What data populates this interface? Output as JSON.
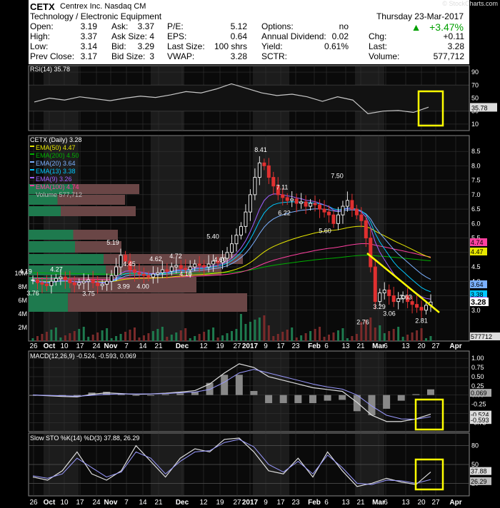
{
  "watermark": "© StockCharts.com",
  "header": {
    "ticker": "CETX",
    "company": "Centrex Inc.",
    "exchange": "Nasdaq CM",
    "sector": "Technology / Electronic Equipment",
    "date": "Thursday 23-Mar-2017",
    "change_pct": "+3.47%",
    "rows": [
      {
        "l1": "Open:",
        "v1": "3.19",
        "l2": "Ask:",
        "v2": "3.37",
        "l3": "P/E:",
        "v3": "5.12",
        "l4": "Options:",
        "v4": "no",
        "l5": "",
        "v5": ""
      },
      {
        "l1": "High:",
        "v1": "3.37",
        "l2": "Ask Size:",
        "v2": "4",
        "l3": "EPS:",
        "v3": "0.64",
        "l4": "Annual Dividend:",
        "v4": "0.02",
        "l5": "Chg:",
        "v5": "+0.11"
      },
      {
        "l1": "Low:",
        "v1": "3.14",
        "l2": "Bid:",
        "v2": "3.29",
        "l3": "Last Size:",
        "v3": "100 shrs",
        "l4": "Yield:",
        "v4": "0.61%",
        "l5": "Last:",
        "v5": "3.28"
      },
      {
        "l1": "Prev Close:",
        "v1": "3.17",
        "l2": "Bid Size:",
        "v2": "3",
        "l3": "VWAP:",
        "v3": "3.28",
        "l4": "SCTR:",
        "v4": "",
        "l5": "Volume:",
        "v5": "577,712"
      }
    ]
  },
  "colors": {
    "ema50": "#e6e600",
    "ema200": "#00b000",
    "ema20": "#7ab0ff",
    "ema13": "#00c8ff",
    "ema9": "#a060ff",
    "ema100": "#ff40a0",
    "candle_up": "#e8e8e8",
    "candle_down": "#e03030",
    "trendline": "#ffff00",
    "highlight_box": "#ffff00"
  },
  "chart_data": [
    {
      "type": "line",
      "panel": "RSI",
      "title": "RSI(14) 35.78",
      "last_label": "35.78",
      "y_ticks": [
        "90",
        "70",
        "50",
        "30",
        "10"
      ],
      "ylim": [
        0,
        100
      ],
      "x": [
        "Sep 26",
        "Oct 3",
        "Oct 10",
        "Oct 17",
        "Oct 24",
        "Oct 31",
        "Nov 7",
        "Nov 14",
        "Nov 21",
        "Nov 28",
        "Dec 5",
        "Dec 12",
        "Dec 19",
        "Dec 27",
        "Jan 3",
        "Jan 9",
        "Jan 17",
        "Jan 23",
        "Jan 30",
        "Feb 6",
        "Feb 13",
        "Feb 21",
        "Feb 27",
        "Mar 6",
        "Mar 13",
        "Mar 20",
        "Mar 23"
      ],
      "values": [
        44,
        50,
        47,
        52,
        49,
        46,
        50,
        53,
        51,
        55,
        60,
        58,
        64,
        72,
        65,
        58,
        54,
        56,
        52,
        45,
        52,
        47,
        26,
        30,
        31,
        28,
        36
      ]
    },
    {
      "type": "candlestick",
      "panel": "Price",
      "title": "CETX (Daily) 3.28",
      "legend": [
        "EMA(50) 4.47",
        "EMA(200) 4.50",
        "EMA(20) 3.64",
        "EMA(13) 3.38",
        "EMA(9) 3.26",
        "EMA(100) 4.74",
        "Volume 577,712"
      ],
      "y_ticks": [
        "8.5",
        "8.0",
        "7.5",
        "7.0",
        "6.5",
        "6.0",
        "5.5",
        "5.0",
        "4.5",
        "4.0",
        "3.5",
        "3.0"
      ],
      "volume_ticks": [
        "10M",
        "8M",
        "6M",
        "4M",
        "2M"
      ],
      "ylim": [
        2.5,
        8.8
      ],
      "x_labels": [
        "26",
        "Oct",
        "10",
        "17",
        "24",
        "Nov",
        "7",
        "14",
        "21",
        "Dec",
        "12",
        "19",
        "27",
        "2017",
        "9",
        "17",
        "23",
        "Feb",
        "6",
        "13",
        "21",
        "Mar",
        "6",
        "13",
        "20",
        "27",
        "Apr"
      ],
      "annotations": [
        {
          "label": "4.19",
          "date": "Sep 26",
          "value": 4.19
        },
        {
          "label": "3.76",
          "date": "Sep 28",
          "value": 3.76
        },
        {
          "label": "4.27",
          "date": "Oct 6",
          "value": 4.27
        },
        {
          "label": "3.75",
          "date": "Oct 17",
          "value": 3.75
        },
        {
          "label": "5.19",
          "date": "Oct 31",
          "value": 5.19
        },
        {
          "label": "4.45",
          "date": "Nov 3",
          "value": 4.45
        },
        {
          "label": "3.99",
          "date": "Nov 1",
          "value": 3.99
        },
        {
          "label": "4.00",
          "date": "Nov 10",
          "value": 4.0
        },
        {
          "label": "4.62",
          "date": "Nov 17",
          "value": 4.62
        },
        {
          "label": "4.72",
          "date": "Nov 28",
          "value": 4.72
        },
        {
          "label": "4.10",
          "date": "Nov 30",
          "value": 4.1
        },
        {
          "label": "5.40",
          "date": "Dec 9",
          "value": 5.4
        },
        {
          "label": "4.60",
          "date": "Dec 13",
          "value": 4.6
        },
        {
          "label": "8.41",
          "date": "Jan 3",
          "value": 8.41
        },
        {
          "label": "7.11",
          "date": "Jan 9",
          "value": 7.11
        },
        {
          "label": "6.22",
          "date": "Jan 17",
          "value": 6.22
        },
        {
          "label": "7.50",
          "date": "Feb 10",
          "value": 7.5
        },
        {
          "label": "5.60",
          "date": "Feb 6",
          "value": 5.6
        },
        {
          "label": "3.63",
          "date": "Mar 13",
          "value": 3.63
        },
        {
          "label": "3.29",
          "date": "Mar 3",
          "value": 3.29
        },
        {
          "label": "3.06",
          "date": "Mar 8",
          "value": 3.06
        },
        {
          "label": "2.76",
          "date": "Feb 27",
          "value": 2.76
        },
        {
          "label": "2.81",
          "date": "Mar 20",
          "value": 2.81
        }
      ],
      "ema_last": {
        "ema100": "4.74",
        "ema50": "4.47",
        "ema20": "3.64",
        "ema13": "3.38",
        "ema9": "3.26"
      },
      "last": "3.28",
      "volume_last": "577712",
      "closes": [
        4.05,
        3.95,
        3.9,
        3.85,
        4.0,
        4.1,
        4.15,
        4.05,
        3.95,
        3.88,
        3.95,
        4.0,
        4.05,
        3.95,
        3.85,
        3.9,
        4.0,
        4.2,
        4.5,
        4.9,
        4.7,
        4.4,
        4.3,
        4.25,
        4.2,
        4.15,
        4.25,
        4.3,
        4.4,
        4.35,
        4.5,
        4.55,
        4.45,
        4.4,
        4.5,
        4.6,
        4.55,
        4.5,
        4.6,
        4.7,
        4.65,
        4.8,
        5.0,
        5.3,
        5.6,
        5.9,
        6.4,
        7.0,
        7.6,
        8.1,
        8.0,
        7.6,
        7.3,
        7.0,
        6.9,
        6.8,
        6.85,
        6.7,
        6.75,
        6.6,
        6.7,
        6.65,
        6.5,
        6.4,
        6.3,
        6.0,
        6.3,
        6.6,
        6.8,
        6.5,
        6.3,
        6.1,
        5.5,
        4.5,
        3.3,
        3.6,
        3.7,
        3.5,
        3.3,
        3.4,
        3.5,
        3.3,
        3.2,
        3.1,
        3.0,
        3.17,
        3.28
      ]
    },
    {
      "type": "line",
      "panel": "MACD",
      "title": "MACD(12,26,9) -0.524, -0.593, 0.069",
      "last_labels": [
        "0.069",
        "-0.524",
        "-0.593"
      ],
      "y_ticks": [
        "1.00",
        "0.75",
        "0.50",
        "0.25",
        "0.00",
        "-0.25",
        "-0.50",
        "-0.75"
      ],
      "ylim": [
        -0.9,
        1.1
      ],
      "series": [
        {
          "name": "MACD",
          "values": [
            0.0,
            -0.02,
            -0.04,
            -0.05,
            0.02,
            0.06,
            0.04,
            0.02,
            0.03,
            0.05,
            0.08,
            0.12,
            0.3,
            0.6,
            0.85,
            0.75,
            0.5,
            0.4,
            0.3,
            0.2,
            0.15,
            0.1,
            -0.2,
            -0.55,
            -0.72,
            -0.72,
            -0.65,
            -0.52
          ]
        },
        {
          "name": "Signal",
          "values": [
            0.0,
            -0.01,
            -0.02,
            -0.03,
            -0.01,
            0.02,
            0.03,
            0.03,
            0.03,
            0.04,
            0.06,
            0.08,
            0.15,
            0.35,
            0.6,
            0.7,
            0.6,
            0.5,
            0.4,
            0.3,
            0.22,
            0.16,
            0.0,
            -0.3,
            -0.55,
            -0.65,
            -0.66,
            -0.59
          ]
        }
      ]
    },
    {
      "type": "line",
      "panel": "STO",
      "title": "Slow STO %K(14) %D(3) 37.88, 26.29",
      "last_labels": [
        "37.88",
        "26.29"
      ],
      "y_ticks": [
        "80",
        "50",
        "20"
      ],
      "ylim": [
        0,
        100
      ],
      "series": [
        {
          "name": "%K",
          "values": [
            30,
            25,
            40,
            70,
            35,
            25,
            40,
            80,
            55,
            30,
            60,
            75,
            70,
            90,
            92,
            70,
            40,
            35,
            60,
            30,
            70,
            40,
            15,
            20,
            28,
            22,
            18,
            38
          ]
        },
        {
          "name": "%D",
          "values": [
            32,
            28,
            35,
            60,
            45,
            30,
            38,
            70,
            60,
            35,
            55,
            70,
            72,
            85,
            90,
            78,
            50,
            38,
            55,
            35,
            65,
            45,
            20,
            18,
            25,
            24,
            20,
            26
          ]
        }
      ]
    }
  ]
}
